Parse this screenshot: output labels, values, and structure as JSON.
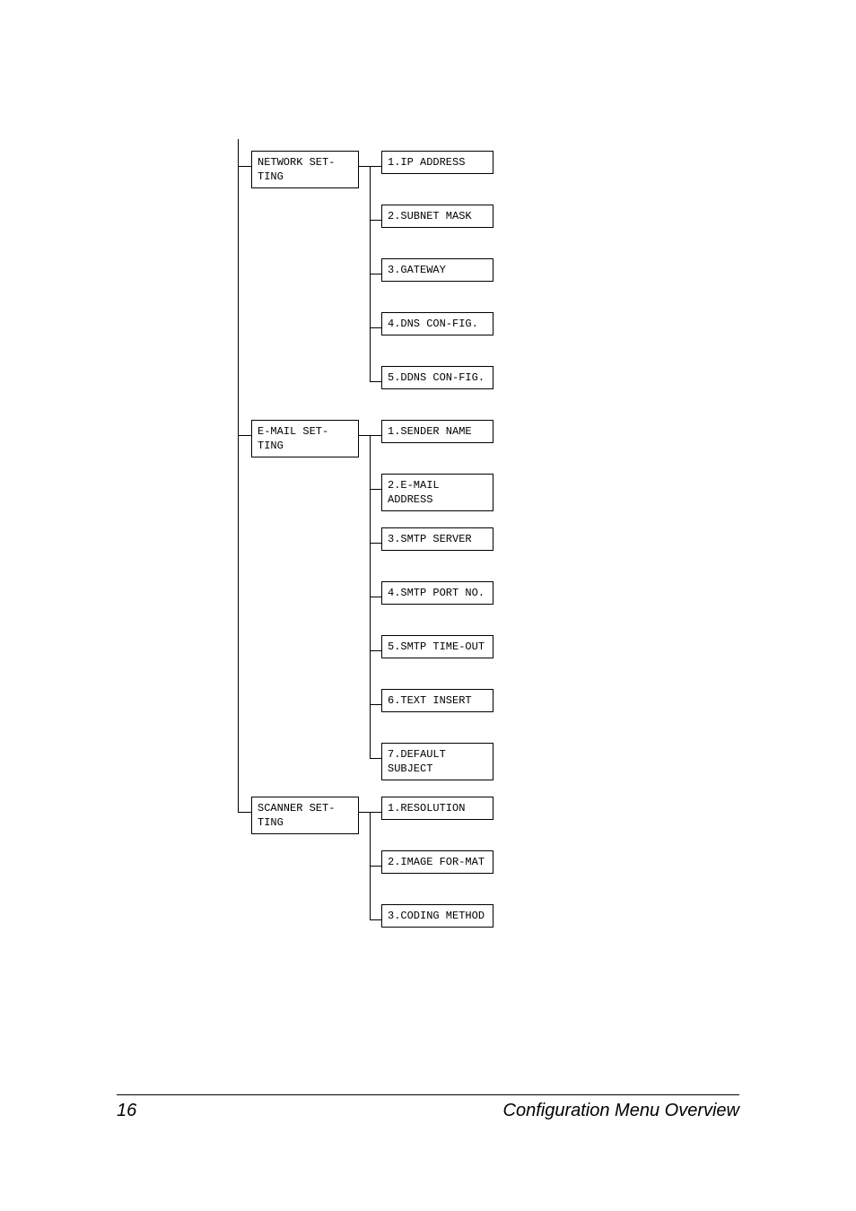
{
  "diagram": {
    "groups": [
      {
        "label": "NETWORK SET-TING",
        "items": [
          "1.IP ADDRESS",
          "2.SUBNET MASK",
          "3.GATEWAY",
          "4.DNS CON-FIG.",
          "5.DDNS CON-FIG."
        ]
      },
      {
        "label": "E-MAIL SET-TING",
        "items": [
          "1.SENDER NAME",
          "2.E-MAIL ADDRESS",
          "3.SMTP SERVER",
          "4.SMTP PORT NO.",
          "5.SMTP TIME-OUT",
          "6.TEXT INSERT",
          "7.DEFAULT SUBJECT"
        ]
      },
      {
        "label": "SCANNER SET-TING",
        "items": [
          "1.RESOLUTION",
          "2.IMAGE FOR-MAT",
          "3.CODING METHOD"
        ]
      }
    ]
  },
  "footer": {
    "page_number": "16",
    "title": "Configuration Menu Overview"
  }
}
